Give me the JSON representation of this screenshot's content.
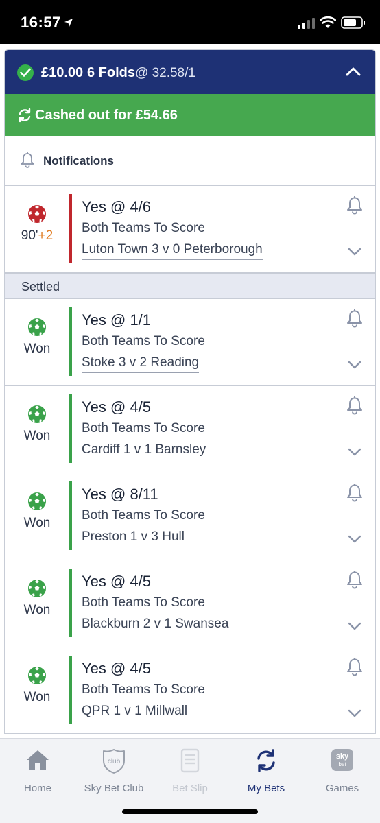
{
  "status_bar": {
    "time": "16:57"
  },
  "bet": {
    "stake": "£10.00",
    "type": "6 Folds",
    "odds": "@ 32.58/1",
    "cashout_text": "Cashed out for £54.66"
  },
  "notifications": {
    "label": "Notifications"
  },
  "settled_label": "Settled",
  "colors": {
    "header": "#1e3175",
    "cashout": "#46a84f",
    "won": "#3aa24a",
    "live": "#c0272d",
    "added_time": "#e07b20"
  },
  "live_selection": {
    "title": "Yes @ 4/6",
    "market": "Both Teams To Score",
    "event": "Luton Town 3 v 0 Peterborough",
    "minute": "90'",
    "added_time": "+2",
    "ball_icon": "red-football-icon"
  },
  "selections": [
    {
      "title": "Yes @ 1/1",
      "market": "Both Teams To Score",
      "event": "Stoke 3 v 2 Reading",
      "status": "Won"
    },
    {
      "title": "Yes @ 4/5",
      "market": "Both Teams To Score",
      "event": "Cardiff 1 v 1 Barnsley",
      "status": "Won"
    },
    {
      "title": "Yes @ 8/11",
      "market": "Both Teams To Score",
      "event": "Preston 1 v 3 Hull",
      "status": "Won"
    },
    {
      "title": "Yes @ 4/5",
      "market": "Both Teams To Score",
      "event": "Blackburn 2 v 1 Swansea",
      "status": "Won"
    },
    {
      "title": "Yes @ 4/5",
      "market": "Both Teams To Score",
      "event": "QPR 1 v 1 Millwall",
      "status": "Won"
    }
  ],
  "tabs": [
    {
      "label": "Home",
      "icon": "home-icon"
    },
    {
      "label": "Sky Bet Club",
      "icon": "club-shield-icon",
      "icon_text": "club"
    },
    {
      "label": "Bet Slip",
      "icon": "bet-slip-icon",
      "state": "disabled"
    },
    {
      "label": "My Bets",
      "icon": "my-bets-icon",
      "state": "active"
    },
    {
      "label": "Games",
      "icon": "games-icon",
      "icon_text_top": "sky",
      "icon_text_bottom": "bet"
    }
  ]
}
